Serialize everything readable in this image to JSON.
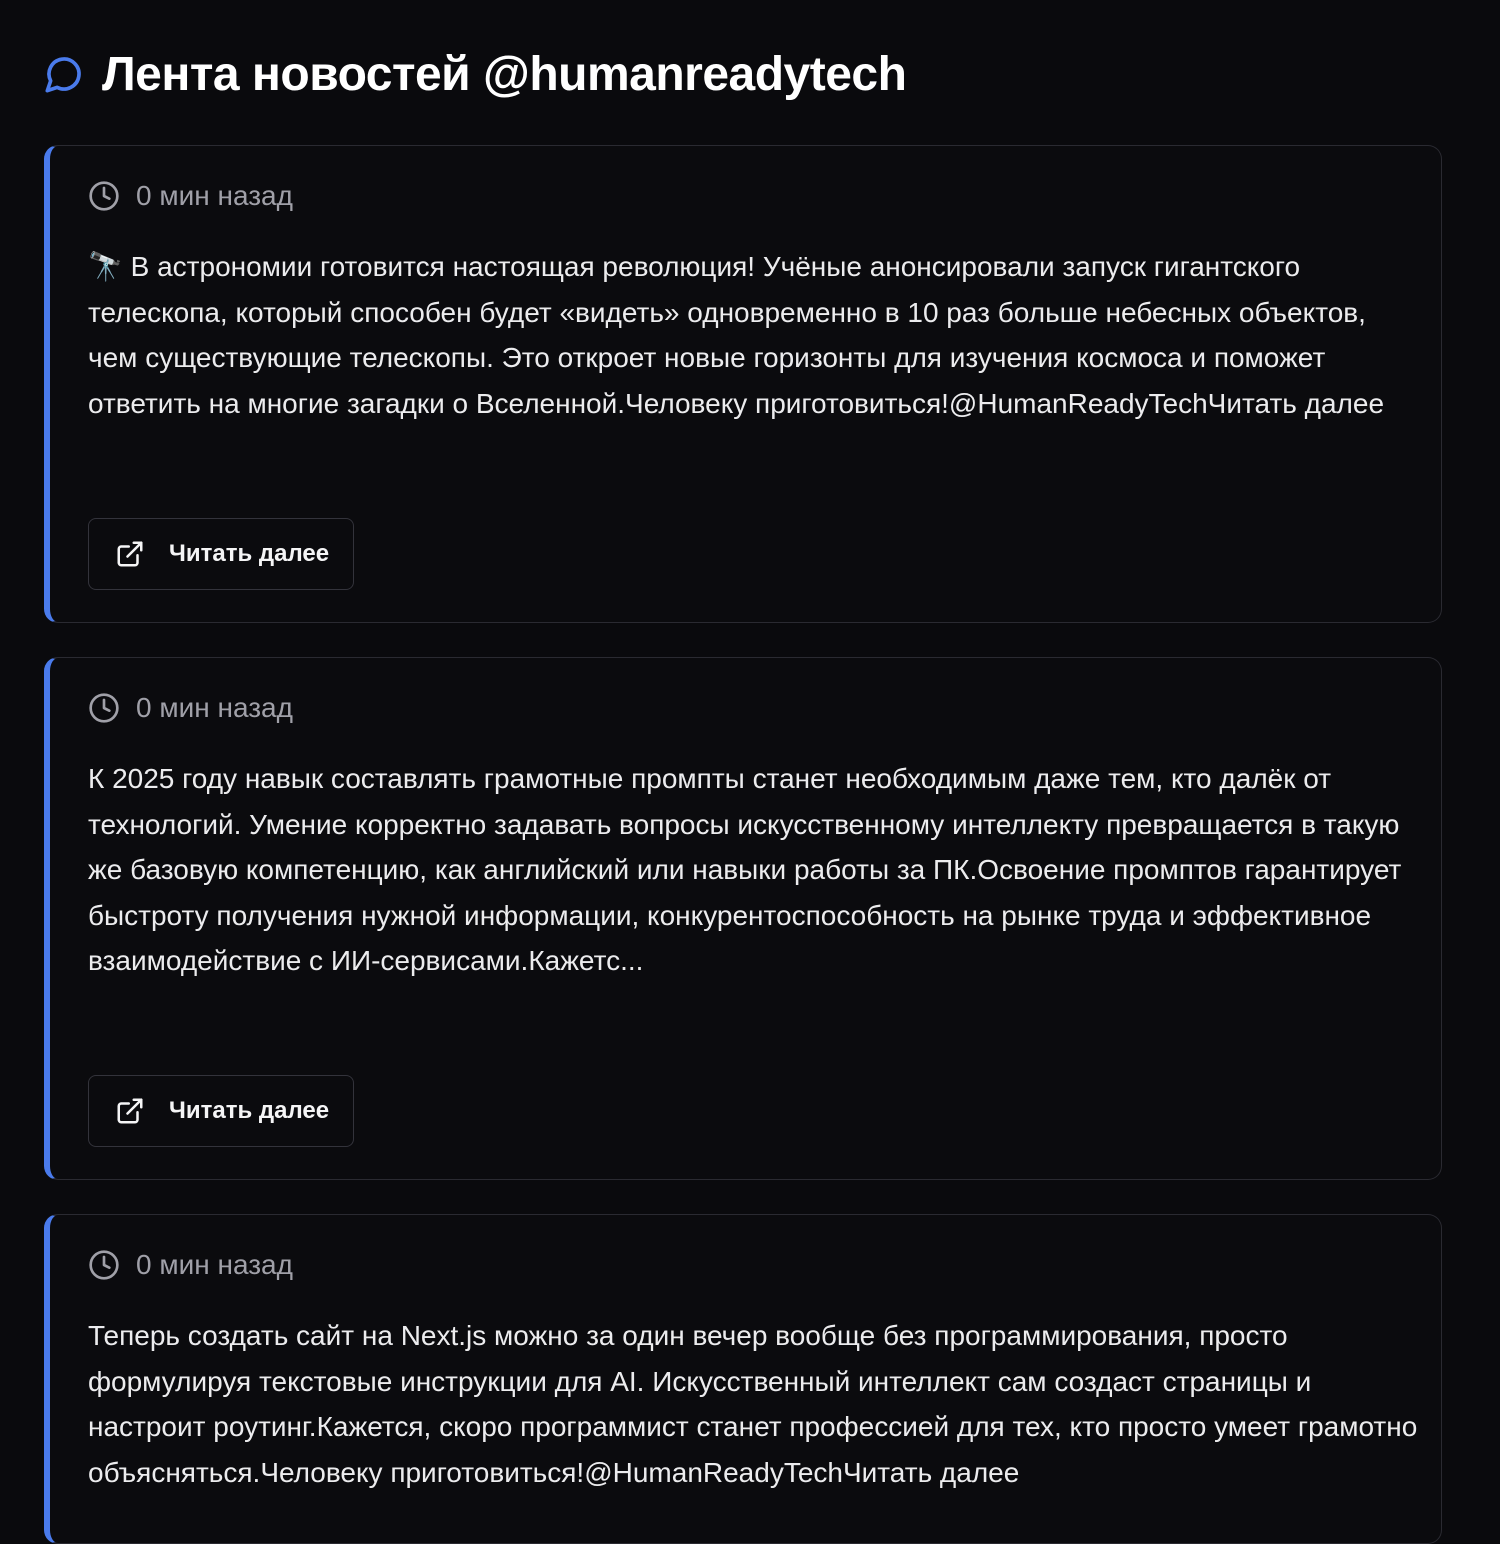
{
  "header": {
    "title": "Лента новостей @humanreadytech",
    "icon": "chat-bubble-icon",
    "accent_color": "#4a7bec"
  },
  "posts": [
    {
      "time": "0 мин назад",
      "text": "🔭 В астрономии готовится настоящая революция! Учёные анонсировали запуск гигантского телескопа, который способен будет «видеть» одновременно в 10 раз больше небесных объектов, чем существующие телескопы. Это откроет новые горизонты для изучения космоса и поможет ответить на многие загадки о Вселенной.Человеку приготовиться!@HumanReadyTechЧитать далее",
      "button_label": "Читать далее"
    },
    {
      "time": "0 мин назад",
      "text": "К 2025 году навык составлять грамотные промпты станет необходимым даже тем, кто далёк от технологий. Умение корректно задавать вопросы искусственному интеллекту превращается в такую же базовую компетенцию, как английский или навыки работы за ПК.Освоение промптов гарантирует быстроту получения нужной информации, конкурентоспособность на рынке труда и эффективное взаимодействие с ИИ-сервисами.Кажетс...",
      "button_label": "Читать далее"
    },
    {
      "time": "0 мин назад",
      "text": "Теперь создать сайт на Next.js можно за один вечер вообще без программирования, просто формулируя текстовые инструкции для AI. Искусственный интеллект сам создаст страницы и настроит роутинг.Кажется, скоро программист станет профессией для тех, кто просто умеет грамотно объясняться.Человеку приготовиться!@HumanReadyTechЧитать далее"
    }
  ]
}
